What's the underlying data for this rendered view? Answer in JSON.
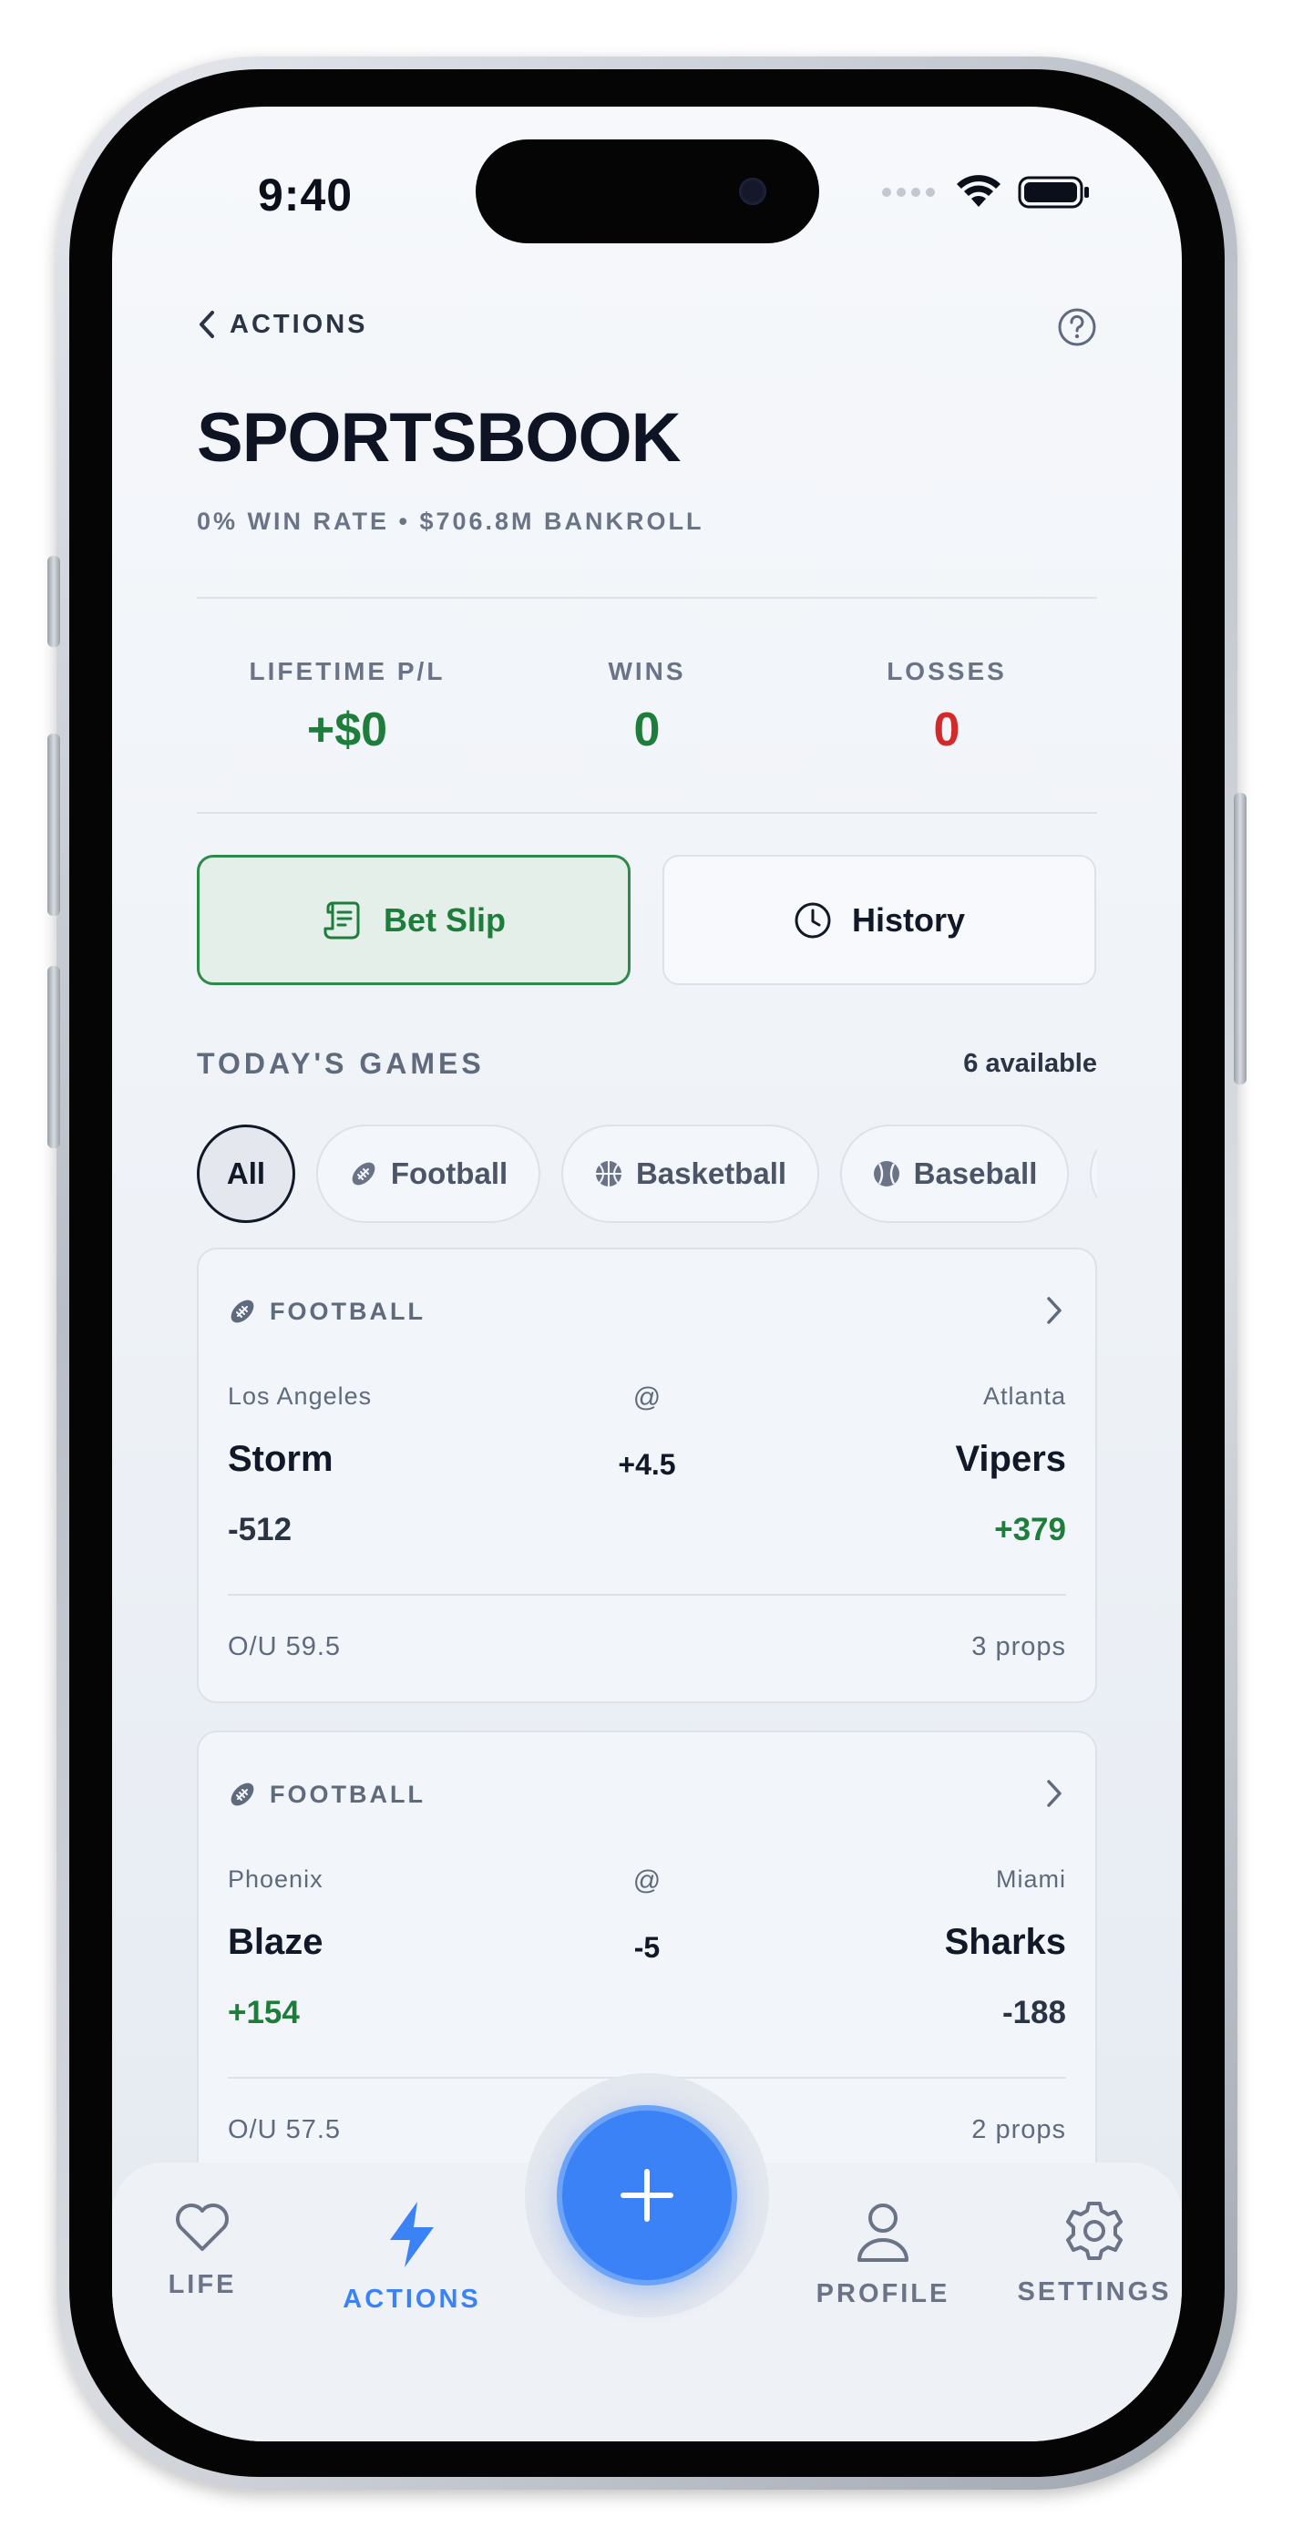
{
  "status_bar": {
    "time": "9:40"
  },
  "header": {
    "back_label": "ACTIONS",
    "title": "SPORTSBOOK",
    "subtitle": "0% WIN RATE • $706.8M BANKROLL"
  },
  "stats": [
    {
      "label": "LIFETIME P/L",
      "value": "+$0",
      "color": "#1f7d3c"
    },
    {
      "label": "WINS",
      "value": "0",
      "color": "#1f7d3c"
    },
    {
      "label": "LOSSES",
      "value": "0",
      "color": "#d22a2a"
    }
  ],
  "actions": {
    "bet_slip": "Bet Slip",
    "history": "History"
  },
  "games_section": {
    "title": "TODAY'S GAMES",
    "count": "6 available"
  },
  "filters": {
    "selected": "All",
    "chips": [
      "All",
      "Football",
      "Basketball",
      "Baseball"
    ]
  },
  "games": [
    {
      "sport": "FOOTBALL",
      "away_city": "Los Angeles",
      "away_team": "Storm",
      "away_odds": "-512",
      "home_city": "Atlanta",
      "home_team": "Vipers",
      "home_odds": "+379",
      "at": "@",
      "spread": "+4.5",
      "over_under": "O/U 59.5",
      "props": "3 props"
    },
    {
      "sport": "FOOTBALL",
      "away_city": "Phoenix",
      "away_team": "Blaze",
      "away_odds": "+154",
      "home_city": "Miami",
      "home_team": "Sharks",
      "home_odds": "-188",
      "at": "@",
      "spread": "-5",
      "over_under": "O/U 57.5",
      "props": "2 props"
    }
  ],
  "nav": {
    "life": "LIFE",
    "actions": "ACTIONS",
    "profile": "PROFILE",
    "settings": "SETTINGS"
  },
  "colors": {
    "accent": "#3b82f6",
    "positive": "#1f7d3c",
    "negative": "#d22a2a"
  }
}
